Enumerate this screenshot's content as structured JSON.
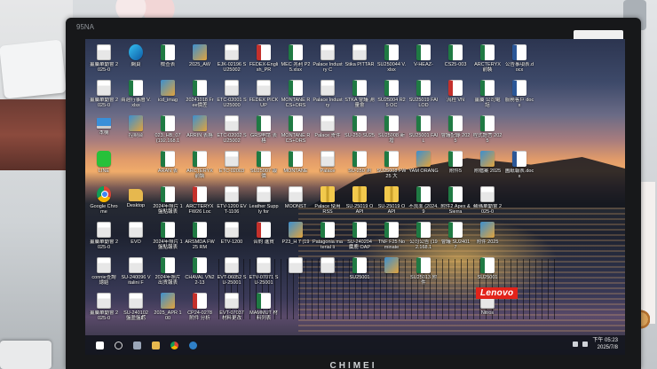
{
  "monitor": {
    "model_tag": "95NA",
    "brand": "CHIMEI"
  },
  "screen": {
    "lenovo_logo": "Lenovo",
    "desktop_icons": [
      {
        "label": "薑屬單動會 2025-0",
        "kind": "doc"
      },
      {
        "label": "網頁",
        "kind": "edge"
      },
      {
        "label": "檢查表",
        "kind": "xls"
      },
      {
        "label": "2025_AW",
        "kind": "img"
      },
      {
        "label": "EJK-02196 SU25002",
        "kind": "doc"
      },
      {
        "label": "FEDEX-English_PR",
        "kind": "pdf"
      },
      {
        "label": "MEC 兆利 P25.xlsx",
        "kind": "xls"
      },
      {
        "label": "Palace Industry C",
        "kind": "doc"
      },
      {
        "label": "Stika PITTAR",
        "kind": "doc"
      },
      {
        "label": "SU250044 V.xlsx",
        "kind": "xls"
      },
      {
        "label": "V-HEAZ-",
        "kind": "xls"
      },
      {
        "label": "CS25-003",
        "kind": "xls"
      },
      {
        "label": "ARCTERYX 前裝",
        "kind": "xls"
      },
      {
        "label": "公告事項表.docx",
        "kind": "word"
      },
      {
        "label": "薑屬單動會 2025-0",
        "kind": "doc"
      },
      {
        "label": "兩週行事曆 V.xlsx",
        "kind": "xls"
      },
      {
        "label": "icd_imag",
        "kind": "img"
      },
      {
        "label": "20241018 Free價差",
        "kind": "xls"
      },
      {
        "label": "ETC-02001 SU25000",
        "kind": "doc"
      },
      {
        "label": "FEDEX PICK UP",
        "kind": "doc"
      },
      {
        "label": "MONTANE RCS+ORS",
        "kind": "xls"
      },
      {
        "label": "Palace Industry",
        "kind": "doc"
      },
      {
        "label": "STKA 會議 測量會",
        "kind": "xls"
      },
      {
        "label": "SU25004 R25 OC",
        "kind": "xls"
      },
      {
        "label": "SU25019 FAILOD",
        "kind": "xls"
      },
      {
        "label": "流程 VN",
        "kind": "pdf"
      },
      {
        "label": "薑屬 公司電話",
        "kind": "xls"
      },
      {
        "label": "服務客戶 docx",
        "kind": "word"
      },
      {
        "label": "本機",
        "kind": "pc"
      },
      {
        "label": "控制台",
        "kind": "img"
      },
      {
        "label": "023_HB_07 (192.168.1",
        "kind": "xls"
      },
      {
        "label": "ARRIN 表格",
        "kind": "img"
      },
      {
        "label": "ETC-02002 SU25002",
        "kind": "doc"
      },
      {
        "label": "GRS申請 表格",
        "kind": "xls"
      },
      {
        "label": "MONTANE RCS+ORS",
        "kind": "xls"
      },
      {
        "label": "Palace 寄件",
        "kind": "doc"
      },
      {
        "label": "SU-250 SU25",
        "kind": "xls"
      },
      {
        "label": "SU25008 新增",
        "kind": "xls"
      },
      {
        "label": "SU25001 FAIL",
        "kind": "xls"
      },
      {
        "label": "會議記錄 2025",
        "kind": "xls"
      },
      {
        "label": "程式語言 2025",
        "kind": "xls"
      },
      {
        "label": "",
        "kind": "none"
      },
      {
        "label": "LINE",
        "kind": "line"
      },
      {
        "label": "",
        "kind": "none"
      },
      {
        "label": "ARAN 表",
        "kind": "xls"
      },
      {
        "label": "ARCTERYX 前裝",
        "kind": "xls"
      },
      {
        "label": "ETC-02003",
        "kind": "doc"
      },
      {
        "label": "SU25007 報價",
        "kind": "xls"
      },
      {
        "label": "MONTANE",
        "kind": "xls"
      },
      {
        "label": "Palace",
        "kind": "doc"
      },
      {
        "label": "SU-250 測",
        "kind": "xls"
      },
      {
        "label": "SU25008 FW25 大",
        "kind": "xls"
      },
      {
        "label": "YAM ORANG",
        "kind": "img"
      },
      {
        "label": "附件5",
        "kind": "xls"
      },
      {
        "label": "附檔案 2025",
        "kind": "img"
      },
      {
        "label": "圖紙報表.docx",
        "kind": "word"
      },
      {
        "label": "Google Chrome",
        "kind": "chrome"
      },
      {
        "label": "Desktop",
        "kind": "folder"
      },
      {
        "label": "2024年照片 1盤點報表",
        "kind": "xls"
      },
      {
        "label": "ARC'TERYX FW26 Loc",
        "kind": "pdf"
      },
      {
        "label": "ETV-1200 EVT-1106",
        "kind": "doc"
      },
      {
        "label": "Leather Supply for",
        "kind": "doc"
      },
      {
        "label": "MOONST",
        "kind": "doc"
      },
      {
        "label": "Palace 使用 RSS",
        "kind": "zip"
      },
      {
        "label": "SU-25019 OAPI",
        "kind": "zip"
      },
      {
        "label": "SU-25019 OAPI",
        "kind": "zip"
      },
      {
        "label": "不良率 (2024.9",
        "kind": "xls"
      },
      {
        "label": "附件2 Apex & Sierra",
        "kind": "xls"
      },
      {
        "label": "蘇瑪單動會 2025-0",
        "kind": "doc"
      },
      {
        "label": "",
        "kind": "none"
      },
      {
        "label": "薑屬單動會 2025-0",
        "kind": "doc"
      },
      {
        "label": "EVO",
        "kind": "doc"
      },
      {
        "label": "2024年照片 1盤點報表",
        "kind": "xls"
      },
      {
        "label": "ARSMDA FW25 RM",
        "kind": "xls"
      },
      {
        "label": "ETV-1200",
        "kind": "doc"
      },
      {
        "label": "合約 進貨",
        "kind": "pdf"
      },
      {
        "label": "P23_H 7 (19",
        "kind": "img"
      },
      {
        "label": "Patagonia material li",
        "kind": "xls"
      },
      {
        "label": "SU-240204 麋鹿 OAP",
        "kind": "xls"
      },
      {
        "label": "TNF F25 Nominate",
        "kind": "xls"
      },
      {
        "label": "公司公告 (192.168.1",
        "kind": "xls"
      },
      {
        "label": "會議 SU24017",
        "kind": "xls"
      },
      {
        "label": "附件 2025",
        "kind": "img"
      },
      {
        "label": "",
        "kind": "none"
      },
      {
        "label": "connie查詢 總結",
        "kind": "doc"
      },
      {
        "label": "SU-240096 Vitalini F",
        "kind": "doc"
      },
      {
        "label": "2024年照片 出貨報表",
        "kind": "xls"
      },
      {
        "label": "CHAVAL VN22-13",
        "kind": "xls"
      },
      {
        "label": "EVT-06052 SU-25001",
        "kind": "doc"
      },
      {
        "label": "ETV-07071 SU-25001",
        "kind": "doc"
      },
      {
        "label": "",
        "kind": "doc"
      },
      {
        "label": "",
        "kind": "doc"
      },
      {
        "label": "SU25001",
        "kind": "xls"
      },
      {
        "label": "",
        "kind": "img"
      },
      {
        "label": "SU25013 附件",
        "kind": "xls"
      },
      {
        "label": "",
        "kind": "none"
      },
      {
        "label": "SU25001",
        "kind": "xls"
      },
      {
        "label": "",
        "kind": "none"
      },
      {
        "label": "薑屬單動會 2025-0",
        "kind": "doc"
      },
      {
        "label": "SU-240102 盤盈盤虧",
        "kind": "doc"
      },
      {
        "label": "2025_APR 100",
        "kind": "img"
      },
      {
        "label": "CP24-0278 附件 分析",
        "kind": "pdf"
      },
      {
        "label": "EVT-07037 材料更改",
        "kind": "doc"
      },
      {
        "label": "MAMMUT 材料列表",
        "kind": "xls"
      },
      {
        "label": "",
        "kind": "none"
      },
      {
        "label": "",
        "kind": "none"
      },
      {
        "label": "",
        "kind": "none"
      },
      {
        "label": "",
        "kind": "none"
      },
      {
        "label": "",
        "kind": "none"
      },
      {
        "label": "",
        "kind": "none"
      },
      {
        "label": "Nitros",
        "kind": "doc"
      },
      {
        "label": "",
        "kind": "none"
      }
    ],
    "taskbar": {
      "clock_time": "下午 05:23",
      "clock_date": "2025/7/8"
    }
  }
}
